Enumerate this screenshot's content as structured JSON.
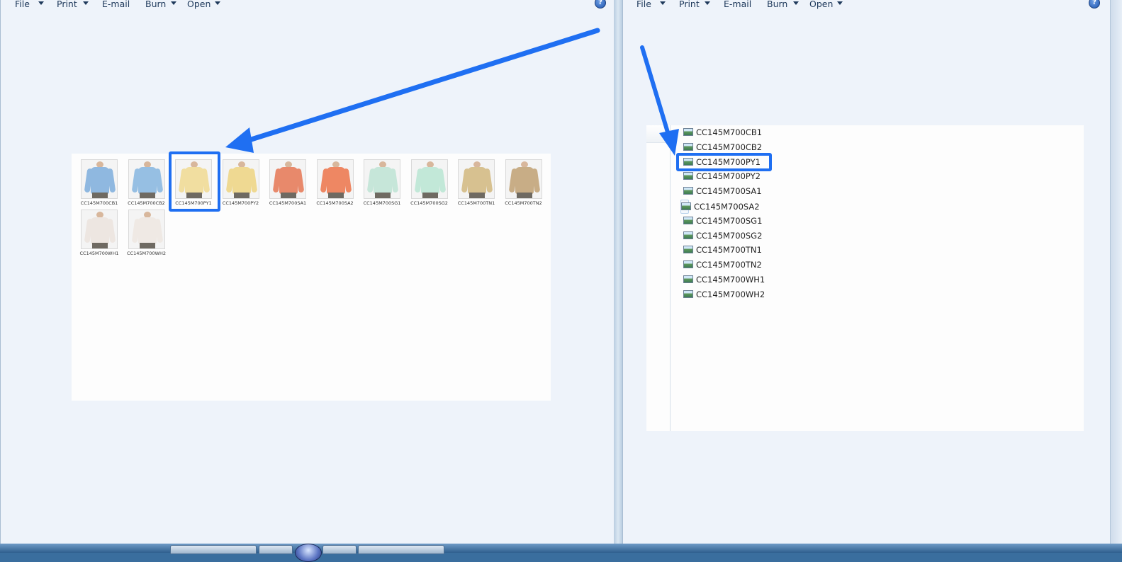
{
  "menu": {
    "items": [
      "File",
      "Print",
      "E-mail",
      "Burn",
      "Open"
    ],
    "help": "?"
  },
  "left_window": {
    "thumbnails": [
      {
        "label": "CC145M700CB1",
        "color": "#8fb8e0"
      },
      {
        "label": "CC145M700CB2",
        "color": "#96bfe3"
      },
      {
        "label": "CC145M700PY1",
        "color": "#f1dea0"
      },
      {
        "label": "CC145M700PY2",
        "color": "#efd992"
      },
      {
        "label": "CC145M700SA1",
        "color": "#e8896b"
      },
      {
        "label": "CC145M700SA2",
        "color": "#ee8763"
      },
      {
        "label": "CC145M700SG1",
        "color": "#c6e6d9"
      },
      {
        "label": "CC145M700SG2",
        "color": "#c2e8d8"
      },
      {
        "label": "CC145M700TN1",
        "color": "#d7c190"
      },
      {
        "label": "CC145M700TN2",
        "color": "#c8ad86"
      },
      {
        "label": "CC145M700WH1",
        "color": "#ede6e1"
      },
      {
        "label": "CC145M700WH2",
        "color": "#efe9e4"
      }
    ],
    "highlighted": "CC145M700PY1"
  },
  "right_window": {
    "files": [
      "CC145M700CB1",
      "CC145M700CB2",
      "CC145M700PY1",
      "CC145M700PY2",
      "CC145M700SA1",
      "CC145M700SA2",
      "CC145M700SG1",
      "CC145M700SG2",
      "CC145M700TN1",
      "CC145M700TN2",
      "CC145M700WH1",
      "CC145M700WH2"
    ],
    "highlighted": "CC145M700PY1",
    "hover_outlined": "CC145M700SA2"
  },
  "colors": {
    "accent_highlight": "#1f6ff2",
    "window_bg": "#eef3fa",
    "pants": "#6f6a62"
  }
}
